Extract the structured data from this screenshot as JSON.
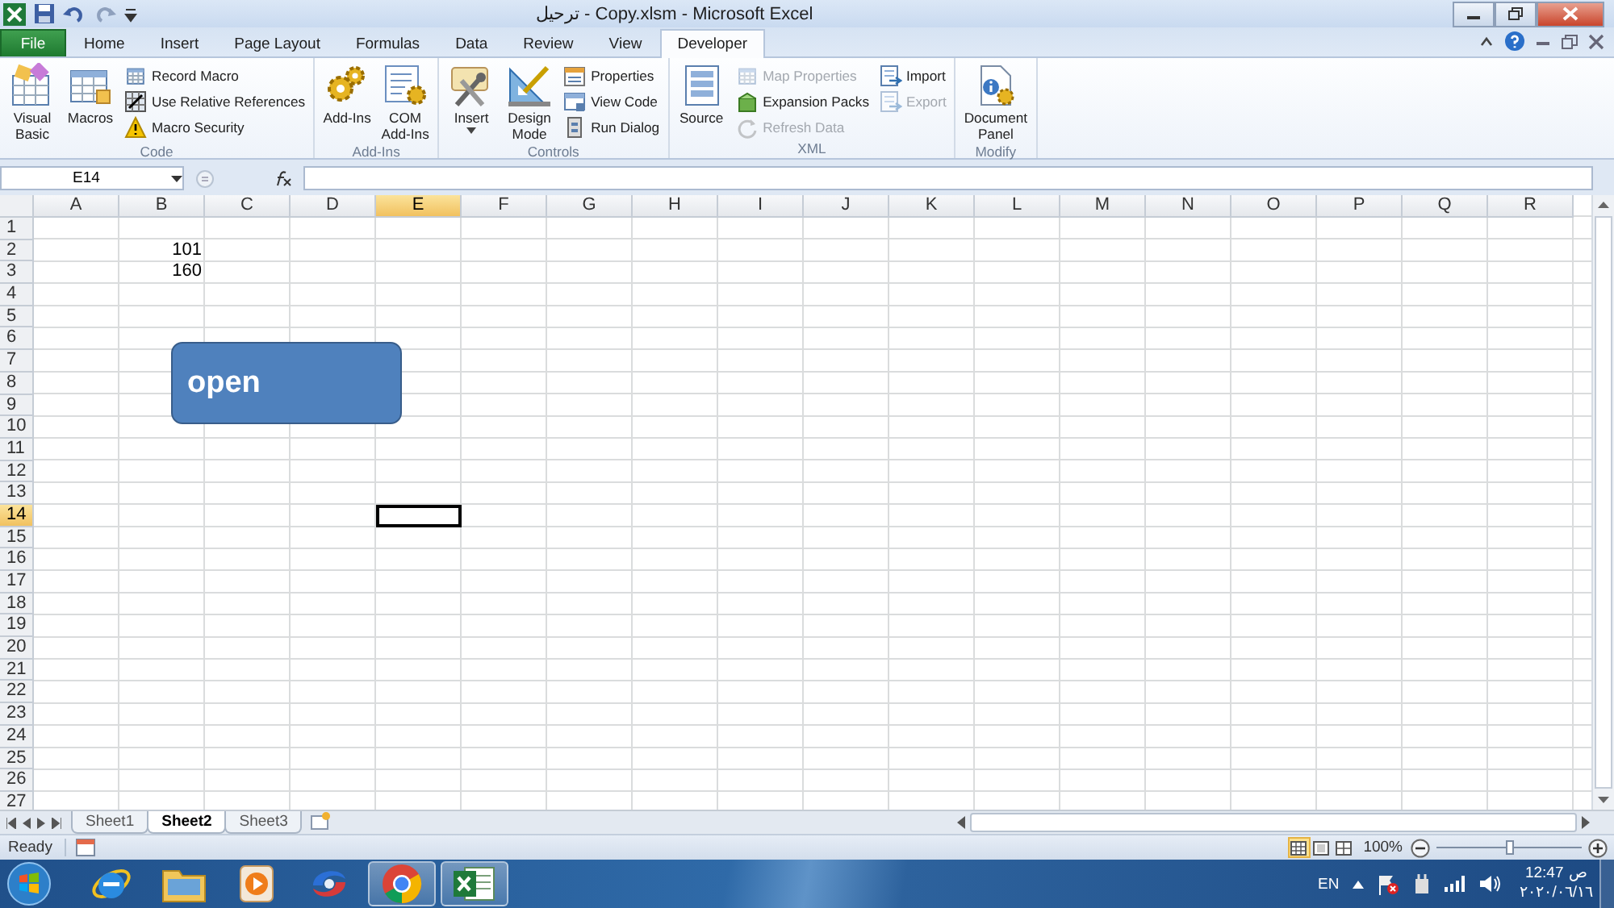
{
  "window": {
    "title": "ترحيل - Copy.xlsm - Microsoft Excel"
  },
  "tabs": [
    {
      "label": "File",
      "kind": "file",
      "selected": false
    },
    {
      "label": "Home",
      "kind": "tab",
      "selected": false
    },
    {
      "label": "Insert",
      "kind": "tab",
      "selected": false
    },
    {
      "label": "Page Layout",
      "kind": "tab",
      "selected": false
    },
    {
      "label": "Formulas",
      "kind": "tab",
      "selected": false
    },
    {
      "label": "Data",
      "kind": "tab",
      "selected": false
    },
    {
      "label": "Review",
      "kind": "tab",
      "selected": false
    },
    {
      "label": "View",
      "kind": "tab",
      "selected": false
    },
    {
      "label": "Developer",
      "kind": "tab",
      "selected": true
    }
  ],
  "ribbon": {
    "groups": [
      {
        "label": "Code",
        "large": [
          {
            "label": "Visual\nBasic",
            "dropdown": false
          },
          {
            "label": "Macros",
            "dropdown": false
          }
        ],
        "small": [
          {
            "label": "Record Macro",
            "disabled": false
          },
          {
            "label": "Use Relative References",
            "disabled": false
          },
          {
            "label": "Macro Security",
            "disabled": false
          }
        ]
      },
      {
        "label": "Add-Ins",
        "large": [
          {
            "label": "Add-Ins",
            "dropdown": false
          },
          {
            "label": "COM\nAdd-Ins",
            "dropdown": false
          }
        ]
      },
      {
        "label": "Controls",
        "large": [
          {
            "label": "Insert",
            "dropdown": true
          },
          {
            "label": "Design\nMode",
            "dropdown": false
          }
        ],
        "small": [
          {
            "label": "Properties",
            "disabled": false
          },
          {
            "label": "View Code",
            "disabled": false
          },
          {
            "label": "Run Dialog",
            "disabled": false
          }
        ]
      },
      {
        "label": "XML",
        "large": [
          {
            "label": "Source",
            "dropdown": false
          }
        ],
        "small": [
          {
            "label": "Map Properties",
            "disabled": true
          },
          {
            "label": "Expansion Packs",
            "disabled": false
          },
          {
            "label": "Refresh Data",
            "disabled": true
          }
        ],
        "small_2": [
          {
            "label": "Import",
            "disabled": false
          },
          {
            "label": "Export",
            "disabled": true
          }
        ]
      },
      {
        "label": "Modify",
        "large": [
          {
            "label": "Document\nPanel",
            "dropdown": false
          }
        ]
      }
    ]
  },
  "formula_bar": {
    "name_box": "E14"
  },
  "grid": {
    "columns": [
      {
        "label": "A",
        "selected": false
      },
      {
        "label": "B",
        "selected": false
      },
      {
        "label": "C",
        "selected": false
      },
      {
        "label": "D",
        "selected": false
      },
      {
        "label": "E",
        "selected": true
      },
      {
        "label": "F",
        "selected": false
      },
      {
        "label": "G",
        "selected": false
      },
      {
        "label": "H",
        "selected": false
      },
      {
        "label": "I",
        "selected": false
      },
      {
        "label": "J",
        "selected": false
      },
      {
        "label": "K",
        "selected": false
      },
      {
        "label": "L",
        "selected": false
      },
      {
        "label": "M",
        "selected": false
      },
      {
        "label": "N",
        "selected": false
      },
      {
        "label": "O",
        "selected": false
      },
      {
        "label": "P",
        "selected": false
      },
      {
        "label": "Q",
        "selected": false
      },
      {
        "label": "R",
        "selected": false
      }
    ],
    "rows": [
      {
        "label": "1",
        "selected": false
      },
      {
        "label": "2",
        "selected": false,
        "cells": [
          null,
          "101"
        ]
      },
      {
        "label": "3",
        "selected": false,
        "cells": [
          null,
          "160"
        ]
      },
      {
        "label": "4",
        "selected": false
      },
      {
        "label": "5",
        "selected": false
      },
      {
        "label": "6",
        "selected": false
      },
      {
        "label": "7",
        "selected": false
      },
      {
        "label": "8",
        "selected": false
      },
      {
        "label": "9",
        "selected": false
      },
      {
        "label": "10",
        "selected": false
      },
      {
        "label": "11",
        "selected": false
      },
      {
        "label": "12",
        "selected": false
      },
      {
        "label": "13",
        "selected": false
      },
      {
        "label": "14",
        "selected": true
      },
      {
        "label": "15",
        "selected": false
      },
      {
        "label": "16",
        "selected": false
      },
      {
        "label": "17",
        "selected": false
      },
      {
        "label": "18",
        "selected": false
      },
      {
        "label": "19",
        "selected": false
      },
      {
        "label": "20",
        "selected": false
      },
      {
        "label": "21",
        "selected": false
      },
      {
        "label": "22",
        "selected": false
      },
      {
        "label": "23",
        "selected": false
      },
      {
        "label": "24",
        "selected": false
      },
      {
        "label": "25",
        "selected": false
      },
      {
        "label": "26",
        "selected": false
      },
      {
        "label": "27",
        "selected": false
      }
    ]
  },
  "shape": {
    "text": "open"
  },
  "sheet_tabs": [
    {
      "label": "Sheet1",
      "selected": false
    },
    {
      "label": "Sheet2",
      "selected": true
    },
    {
      "label": "Sheet3",
      "selected": false
    }
  ],
  "status_bar": {
    "status": "Ready",
    "views": [
      {
        "selected": true
      },
      {
        "selected": false
      },
      {
        "selected": false
      }
    ],
    "zoom": "100%",
    "zoom_slider": {
      "level": 0.5
    }
  },
  "taskbar": {
    "apps": [
      {
        "kind": "ie",
        "running": false
      },
      {
        "kind": "folder",
        "running": false
      },
      {
        "kind": "media",
        "running": false
      },
      {
        "kind": "swirl",
        "running": false
      },
      {
        "kind": "chrome",
        "running": true
      },
      {
        "kind": "excel",
        "running": true
      }
    ],
    "language": "EN",
    "time": "12:47",
    "period": "ص",
    "date": "٢٠٢٠/٠٦/١٦"
  }
}
